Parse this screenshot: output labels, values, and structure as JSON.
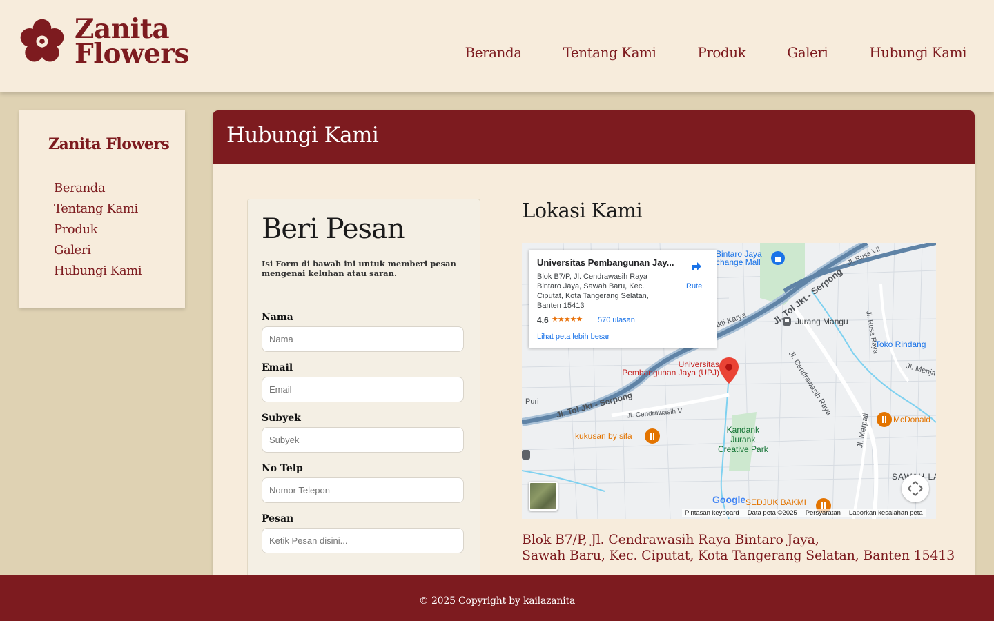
{
  "brand": {
    "line1": "Zanita",
    "line2": "Flowers",
    "color": "#7d1b1f"
  },
  "nav": [
    "Beranda",
    "Tentang Kami",
    "Produk",
    "Galeri",
    "Hubungi Kami"
  ],
  "sidebar": {
    "title": "Zanita Flowers",
    "items": [
      "Beranda",
      "Tentang Kami",
      "Produk",
      "Galeri",
      "Hubungi Kami"
    ]
  },
  "panel": {
    "title": "Hubungi Kami"
  },
  "form": {
    "title": "Beri Pesan",
    "description": "Isi Form di bawah ini untuk memberi pesan mengenai keluhan atau saran.",
    "fields": [
      {
        "label": "Nama",
        "placeholder": "Nama"
      },
      {
        "label": "Email",
        "placeholder": "Email"
      },
      {
        "label": "Subyek",
        "placeholder": "Subyek"
      },
      {
        "label": "No Telp",
        "placeholder": "Nomor Telepon"
      },
      {
        "label": "Pesan",
        "placeholder": "Ketik Pesan disini..."
      }
    ]
  },
  "location": {
    "title": "Lokasi Kami",
    "map": {
      "place_name": "Universitas Pembangunan Jay...",
      "place_address": "Blok B7/P, Jl. Cendrawasih Raya Bintaro Jaya, Sawah Baru, Kec. Ciputat, Kota Tangerang Selatan, Banten 15413",
      "rating": "4,6",
      "stars": "★★★★★",
      "reviews": "570 ulasan",
      "route": "Rute",
      "bigger_map": "Lihat peta lebih besar",
      "pin_label_1": "Universitas",
      "pin_label_2": "Pembangunan Jaya (UPJ)",
      "labels": {
        "bintaro_1": "Bintaro Jaya",
        "bintaro_2": "change Mall",
        "jurang_mangu": "Jurang Mangu",
        "toko_rindang": "Toko Rindang",
        "mcdonald": "McDonald",
        "kukusan": "kukusan by sifa",
        "kandank_1": "Kandank",
        "kandank_2": "Jurank",
        "kandank_3": "Creative Park",
        "sedjuk": "SEDJUK BAKMI",
        "sawah": "SAWAH LAM",
        "puri": "Puri",
        "toll_1": "Jl. Tol Jkt - Serpong",
        "toll_2": "Jl. Tol Jkt - Serpong",
        "cendrawasih_1": "Jl. Cendrawasih V",
        "cendrawasih_2": "Jl. Cendrawasih Raya",
        "bakti_karya": "Bakti Karya",
        "rusa_raya": "Jl. Rusa Raya",
        "rusa_vii": "Jl. Rusa VII",
        "merpati": "Jl. Merpati",
        "menjangan": "Jl. Menja",
        "google": "Google"
      },
      "attribution": [
        "Pintasan keyboard",
        "Data peta ©2025",
        "Persyaratan",
        "Laporkan kesalahan peta"
      ]
    },
    "address_line1": "Blok B7/P, Jl. Cendrawasih Raya Bintaro Jaya,",
    "address_line2": "Sawah Baru, Kec. Ciputat, Kota Tangerang Selatan, Banten 15413"
  },
  "footer": {
    "text": "© 2025 Copyright by kailazanita"
  }
}
